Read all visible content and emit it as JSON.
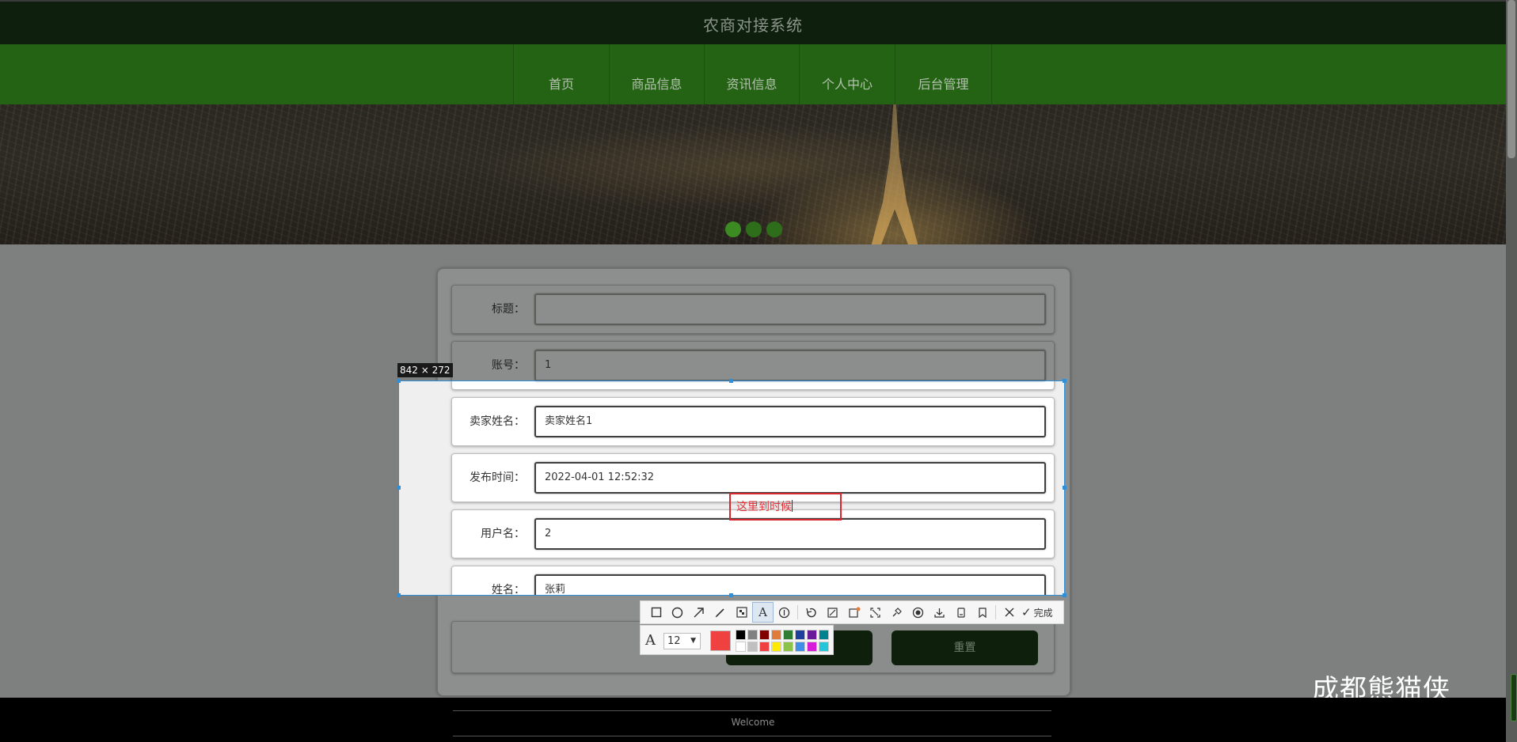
{
  "header": {
    "title": "农商对接系统"
  },
  "nav": {
    "items": [
      {
        "label": "首页"
      },
      {
        "label": "商品信息"
      },
      {
        "label": "资讯信息"
      },
      {
        "label": "个人中心"
      },
      {
        "label": "后台管理"
      }
    ]
  },
  "banner": {
    "slide_count": 3,
    "active_slide": 1
  },
  "form": {
    "fields": [
      {
        "label": "标题：",
        "value": ""
      },
      {
        "label": "账号：",
        "value": "1"
      },
      {
        "label": "卖家姓名：",
        "value": "卖家姓名1"
      },
      {
        "label": "发布时间：",
        "value": "2022-04-01 12:52:32"
      },
      {
        "label": "用户名：",
        "value": "2"
      },
      {
        "label": "姓名：",
        "value": "张莉"
      }
    ],
    "submit_label": "",
    "reset_label": "重置"
  },
  "capture": {
    "size_label": "842 × 272",
    "annotation_text": "这里到时候",
    "font_size": "12",
    "current_color": "#f04141",
    "done_label": "完成",
    "tools": [
      "rect-icon",
      "ellipse-icon",
      "arrow-icon",
      "pen-icon",
      "mosaic-icon",
      "text-icon",
      "number-icon",
      "undo-icon",
      "cut-icon",
      "ocr-icon",
      "screen-record-icon",
      "pin-icon",
      "record-icon",
      "download-icon",
      "save-icon",
      "bookmark-icon",
      "cancel-icon"
    ],
    "palette": [
      "#000000",
      "#808080",
      "#800000",
      "#e07b39",
      "#2e7d32",
      "#1e3f9c",
      "#6a1b9a",
      "#00838f",
      "#ffffff",
      "#c0c0c0",
      "#f04141",
      "#ffeb00",
      "#8bc34a",
      "#3f8fe8",
      "#d81bd8",
      "#26c6da"
    ]
  },
  "watermark": "成都熊猫侠",
  "footer": {
    "text": "Welcome"
  }
}
